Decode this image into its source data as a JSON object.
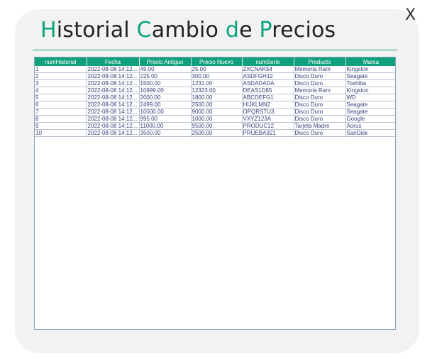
{
  "window": {
    "close_label": "X"
  },
  "title": {
    "parts": [
      "H",
      "istorial ",
      "C",
      "ambio ",
      "d",
      "e ",
      "P",
      "recios"
    ]
  },
  "table": {
    "columns": [
      "numHistorial",
      "Fecha",
      "Precio Antiguo",
      "Precio Nuevo",
      "numSerie",
      "Producto",
      "Marca"
    ],
    "rows": [
      [
        "1",
        "2022-08-08 14:12...",
        "45.00",
        "25.00",
        "ZXCNAK54",
        "Memoria Ram",
        "Kingston"
      ],
      [
        "2",
        "2022-08-08 14:12...",
        "225.00",
        "300.00",
        "ASDFGH12",
        "Disco Duro",
        "Seagate"
      ],
      [
        "3",
        "2022-08-08 14:12...",
        "1500.00",
        "1231.00",
        "ASDADADA",
        "Disco Duro",
        "Toshiba"
      ],
      [
        "4",
        "2022-08-08 14:12...",
        "10999.00",
        "12323.00",
        "DEAS1D85",
        "Memoria Ram",
        "Kingston"
      ],
      [
        "5",
        "2022-08-08 14:12...",
        "2000.00",
        "1800.00",
        "ABCDEFG1",
        "Disco Duro",
        "WD"
      ],
      [
        "6",
        "2022-08-08 14:12...",
        "2499.00",
        "2500.00",
        "HIJKLMN2",
        "Disco Duro",
        "Seagate"
      ],
      [
        "7",
        "2022-08-08 14:12...",
        "10000.00",
        "9000.00",
        "OPQRSTU3",
        "Disco Duro",
        "Seagate"
      ],
      [
        "8",
        "2022-08-08 14:12...",
        "995.00",
        "1000.00",
        "VXYZ123A",
        "Disco Duro",
        "Google"
      ],
      [
        "9",
        "2022-08-08 14:12...",
        "11000.00",
        "9500.00",
        "PRODUC12",
        "Tarjeta Madre",
        "Aorus"
      ],
      [
        "10",
        "2022-08-08 14:12...",
        "3500.00",
        "2500.00",
        "PRUEBA321",
        "Disco Duro",
        "SanDisk"
      ]
    ]
  },
  "colors": {
    "accent": "#10a07c",
    "background_panel": "#f2f2f2",
    "table_text": "#3a3f7a"
  }
}
